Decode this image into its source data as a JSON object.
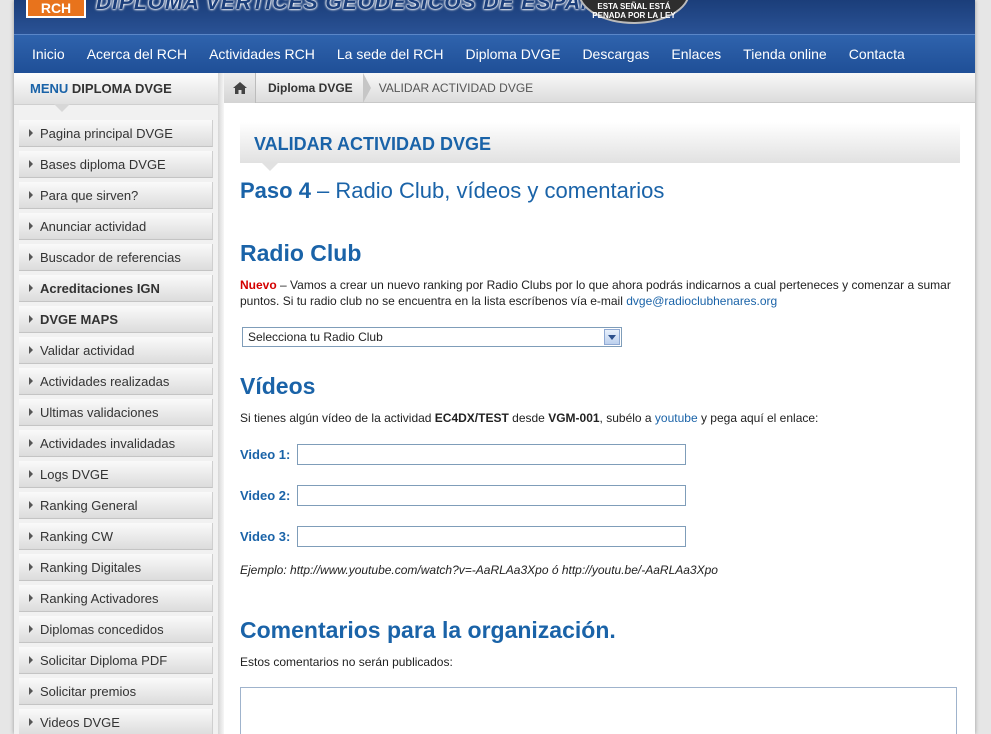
{
  "header": {
    "logo_text": "RCH",
    "banner_title": "DIPLOMA VERTICES GEODESICOS DE ESPAÑA",
    "seal_text": "ESTA SEÑAL ESTÁ PENADA POR LA LEY"
  },
  "nav": {
    "items": [
      {
        "label": "Inicio"
      },
      {
        "label": "Acerca del RCH"
      },
      {
        "label": "Actividades RCH"
      },
      {
        "label": "La sede del RCH"
      },
      {
        "label": "Diploma DVGE"
      },
      {
        "label": "Descargas"
      },
      {
        "label": "Enlaces"
      },
      {
        "label": "Tienda online"
      },
      {
        "label": "Contacta"
      }
    ]
  },
  "sidebar": {
    "heading_highlight": "MENU",
    "heading_rest": "DIPLOMA DVGE",
    "items": [
      {
        "label": "Pagina principal DVGE"
      },
      {
        "label": "Bases diploma DVGE"
      },
      {
        "label": "Para que sirven?"
      },
      {
        "label": "Anunciar actividad"
      },
      {
        "label": "Buscador de referencias"
      },
      {
        "label": "Acreditaciones IGN"
      },
      {
        "label": "DVGE MAPS"
      },
      {
        "label": "Validar actividad"
      },
      {
        "label": "Actividades realizadas"
      },
      {
        "label": "Ultimas validaciones"
      },
      {
        "label": "Actividades invalidadas"
      },
      {
        "label": "Logs DVGE"
      },
      {
        "label": "Ranking General"
      },
      {
        "label": "Ranking CW"
      },
      {
        "label": "Ranking Digitales"
      },
      {
        "label": "Ranking Activadores"
      },
      {
        "label": "Diplomas concedidos"
      },
      {
        "label": "Solicitar Diploma PDF"
      },
      {
        "label": "Solicitar premios"
      },
      {
        "label": "Videos DVGE"
      }
    ]
  },
  "breadcrumb": {
    "parent": "Diploma DVGE",
    "current": "VALIDAR ACTIVIDAD DVGE"
  },
  "main": {
    "title": "VALIDAR ACTIVIDAD DVGE",
    "step_number": "Paso 4",
    "step_text": " – Radio Club, vídeos y comentarios",
    "radio_club": {
      "heading": "Radio Club",
      "new_tag": "Nuevo",
      "note": " – Vamos a crear un nuevo ranking por Radio Clubs por lo que ahora podrás indicarnos a cual perteneces y comenzar a sumar puntos. Si tu radio club no se encuentra en la lista escríbenos vía e-mail ",
      "email": "dvge@radioclubhenares.org",
      "select_value": "Selecciona tu Radio Club"
    },
    "videos": {
      "heading": "Vídeos",
      "intro_1": "Si tienes algún vídeo de la actividad ",
      "activity": "EC4DX/TEST",
      "intro_2": " desde ",
      "reference": "VGM-001",
      "intro_3": ", subélo a ",
      "youtube": "youtube",
      "intro_4": " y pega aquí el enlace:",
      "fields": [
        {
          "label": "Video 1:",
          "value": ""
        },
        {
          "label": "Video 2:",
          "value": ""
        },
        {
          "label": "Video 3:",
          "value": ""
        }
      ],
      "example": "Ejemplo: http://www.youtube.com/watch?v=-AaRLAa3Xpo ó http://youtu.be/-AaRLAa3Xpo"
    },
    "comments": {
      "heading": "Comentarios para la organización.",
      "note": "Estos comentarios no serán publicados:",
      "value": ""
    }
  },
  "colors": {
    "brand_blue": "#1a63a8",
    "nav_blue": "#2a5aa3",
    "new_red": "#d40000"
  }
}
